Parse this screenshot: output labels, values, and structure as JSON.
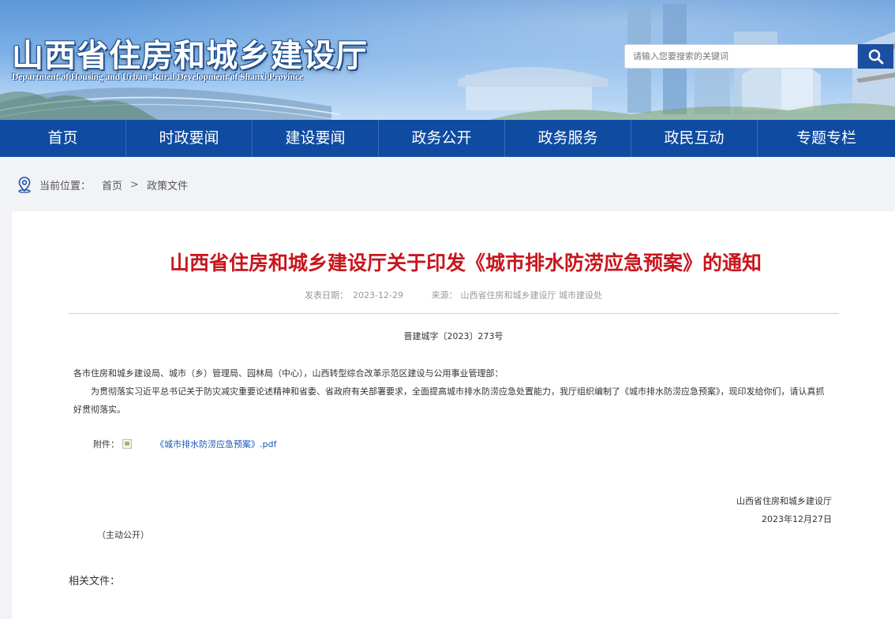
{
  "header": {
    "title": "山西省住房和城乡建设厅",
    "subtitle": "Department of Housing and Urban–Rural Development of Shanxi Province",
    "search_placeholder": "请输入您要搜索的关键词"
  },
  "nav": {
    "items": [
      "首页",
      "时政要闻",
      "建设要闻",
      "政务公开",
      "政务服务",
      "政民互动",
      "专题专栏"
    ]
  },
  "breadcrumb": {
    "label": "当前位置：",
    "home": "首页",
    "separator": ">",
    "current": "政策文件"
  },
  "article": {
    "title": "山西省住房和城乡建设厅关于印发《城市排水防涝应急预案》的通知",
    "date_label": "发表日期：",
    "date": "2023-12-29",
    "source_label": "来源：",
    "source": "山西省住房和城乡建设厅 城市建设处",
    "doc_number": "晋建城字〔2023〕273号",
    "recipients": "各市住房和城乡建设局、城市（乡）管理局、园林局（中心），山西转型综合改革示范区建设与公用事业管理部：",
    "paragraph": "为贯彻落实习近平总书记关于防灾减灾重要论述精神和省委、省政府有关部署要求，全面提高城市排水防涝应急处置能力，我厅组织编制了《城市排水防涝应急预案》，现印发给你们，请认真抓好贯彻落实。",
    "attachment_label": "附件：",
    "attachment_name": "《城市排水防涝应急预案》.pdf",
    "signature_org": "山西省住房和城乡建设厅",
    "signature_date": "2023年12月27日",
    "disclosure": "（主动公开）",
    "related_label": "相关文件："
  },
  "colors": {
    "nav_bg": "#0e4ba1",
    "title_red": "#c8161d",
    "link_blue": "#1a57b5"
  }
}
